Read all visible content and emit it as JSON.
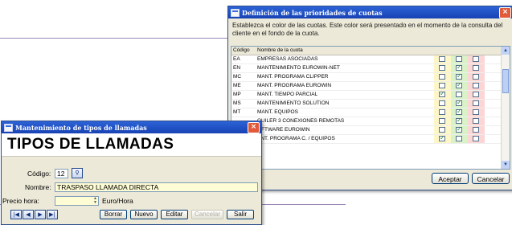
{
  "priorities_window": {
    "title": "Definición de las prioridades de cuotas",
    "close_label": "×",
    "description": "Establezca el color de las cuotas. Este color será presentado en el momento de la consulta del cliente en el fondo de la cuota.",
    "columns": [
      "Código",
      "Nombre de la cuota"
    ],
    "rows": [
      {
        "code": "EA",
        "name": "EMPRESAS ASOCIADAS",
        "checks": [
          false,
          false,
          false
        ]
      },
      {
        "code": "EN",
        "name": "MANTENIMIENTO EUROWIN-NET",
        "checks": [
          false,
          true,
          false
        ]
      },
      {
        "code": "MC",
        "name": "MANT. PROGRAMA CLIPPER",
        "checks": [
          false,
          true,
          false
        ]
      },
      {
        "code": "ME",
        "name": "MANT. PROGRAMA EUROWIN",
        "checks": [
          false,
          true,
          false
        ]
      },
      {
        "code": "MP",
        "name": "MANT. TIEMPO PARCIAL",
        "checks": [
          true,
          false,
          false
        ]
      },
      {
        "code": "MS",
        "name": "MANTENIMIENTO SOLUTION",
        "checks": [
          false,
          true,
          false
        ]
      },
      {
        "code": "MT",
        "name": "MANT. EQUIPOS",
        "checks": [
          false,
          true,
          false
        ]
      },
      {
        "code": "",
        "name": "QUILER 3 CONEXIONES REMOTAS",
        "checks": [
          false,
          true,
          false
        ]
      },
      {
        "code": "",
        "name": "OFTWARE EUROWIN",
        "checks": [
          false,
          true,
          false
        ]
      },
      {
        "code": "",
        "name": "ANT. PROGRAMA C. / EQUIPOS",
        "checks": [
          true,
          false,
          false
        ]
      }
    ],
    "accept_label": "Aceptar",
    "cancel_label": "Cancelar"
  },
  "call_types_window": {
    "title": "Mantenimiento de tipos de llamadas",
    "close_label": "×",
    "heading": "TIPOS DE LLAMADAS",
    "codigo_label": "Código:",
    "codigo_value": "12",
    "nombre_label": "Nombre:",
    "nombre_value": "TRASPASO LLAMADA DIRECTA",
    "precio_label": "Precio hora:",
    "precio_value": "",
    "precio_unit": "Euro/Hora",
    "nav": [
      "|◀",
      "◀",
      "▶",
      "▶|"
    ],
    "buttons": {
      "borrar": "Borrar",
      "nuevo": "Nuevo",
      "editar": "Editar",
      "cancelar": "Cancelar",
      "salir": "Salir"
    }
  }
}
